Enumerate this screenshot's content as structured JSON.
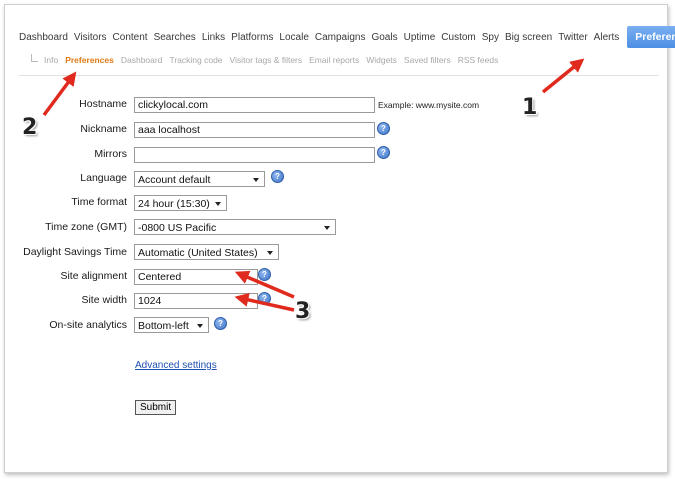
{
  "topnav": {
    "items": [
      "Dashboard",
      "Visitors",
      "Content",
      "Searches",
      "Links",
      "Platforms",
      "Locale",
      "Campaigns",
      "Goals",
      "Uptime",
      "Custom",
      "Spy",
      "Big screen",
      "Twitter",
      "Alerts"
    ],
    "active": "Preferences"
  },
  "subnav": {
    "items": [
      "Info",
      "Preferences",
      "Dashboard",
      "Tracking code",
      "Visitor tags & filters",
      "Email reports",
      "Widgets",
      "Saved filters",
      "RSS feeds"
    ],
    "current_index": 1
  },
  "form": {
    "hostname": {
      "label": "Hostname",
      "value": "clickylocal.com",
      "example": "Example: www.mysite.com"
    },
    "nickname": {
      "label": "Nickname",
      "value": "aaa localhost"
    },
    "mirrors": {
      "label": "Mirrors",
      "value": ""
    },
    "language": {
      "label": "Language",
      "value": "Account default"
    },
    "time_format": {
      "label": "Time format",
      "value": "24 hour (15:30)"
    },
    "time_zone": {
      "label": "Time zone (GMT)",
      "value": "-0800 US Pacific"
    },
    "dst": {
      "label": "Daylight Savings Time",
      "value": "Automatic (United States)"
    },
    "site_alignment": {
      "label": "Site alignment",
      "value": "Centered"
    },
    "site_width": {
      "label": "Site width",
      "value": "1024"
    },
    "onsite_analytics": {
      "label": "On-site analytics",
      "value": "Bottom-left"
    },
    "help_glyph": "?",
    "advanced_link": "Advanced settings",
    "submit_label": "Submit"
  },
  "annotations": {
    "one": "1",
    "two": "2",
    "three": "3",
    "arrow_color": "#e02a1d"
  },
  "colors": {
    "accent": "#5c9be8",
    "current_subnav": "#e07a15",
    "link": "#1f4fb0"
  }
}
